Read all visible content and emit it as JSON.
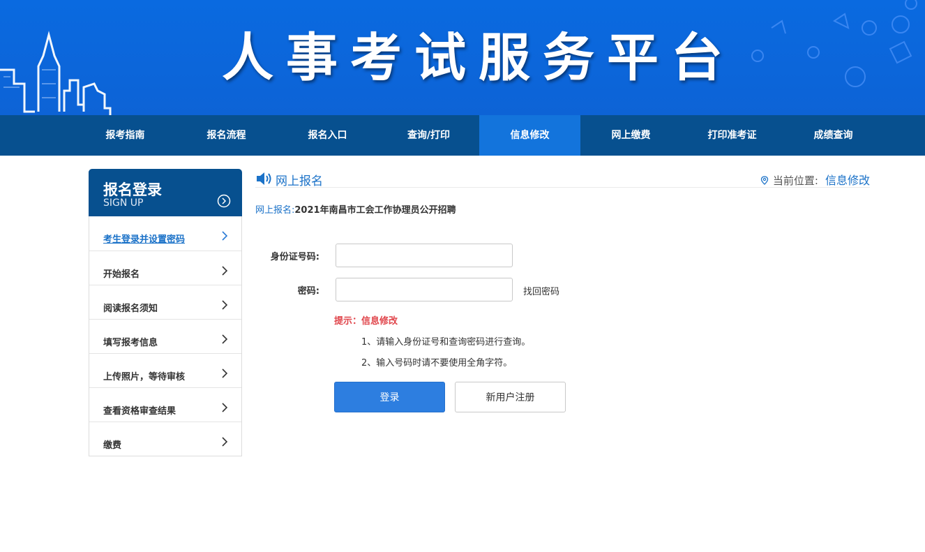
{
  "banner": {
    "title": "人事考试服务平台"
  },
  "nav": {
    "items": [
      {
        "label": "报考指南"
      },
      {
        "label": "报名流程"
      },
      {
        "label": "报名入口"
      },
      {
        "label": "查询/打印"
      },
      {
        "label": "信息修改",
        "active": true
      },
      {
        "label": "网上缴费"
      },
      {
        "label": "打印准考证"
      },
      {
        "label": "成绩查询"
      }
    ]
  },
  "sidebar": {
    "title": "报名登录",
    "subtitle": "SIGN UP",
    "items": [
      {
        "label": "考生登录并设置密码",
        "active": true
      },
      {
        "label": "开始报名"
      },
      {
        "label": "阅读报名须知"
      },
      {
        "label": "填写报考信息"
      },
      {
        "label": "上传照片，等待审核"
      },
      {
        "label": "查看资格审查结果"
      },
      {
        "label": "缴费"
      }
    ]
  },
  "main": {
    "section_title": "网上报名",
    "breadcrumb_label": "当前位置:",
    "breadcrumb_current": "信息修改",
    "subtitle_key": "网上报名:",
    "subtitle_value": "2021年南昌市工会工作协理员公开招聘",
    "form": {
      "id_label": "身份证号码:",
      "id_value": "",
      "password_label": "密码:",
      "password_value": "",
      "forgot_password": "找回密码"
    },
    "hint_title": "提示：信息修改",
    "hints": [
      "1、请输入身份证号和查询密码进行查询。",
      "2、输入号码时请不要使用全角字符。"
    ],
    "login_button": "登录",
    "register_button": "新用户注册"
  },
  "colors": {
    "banner_blue": "#0a6ae0",
    "nav_dark": "#07508f",
    "nav_active": "#1374dc",
    "link_blue": "#1b72c8",
    "hint_red": "#e0454b",
    "button_blue": "#2d7ee0"
  }
}
